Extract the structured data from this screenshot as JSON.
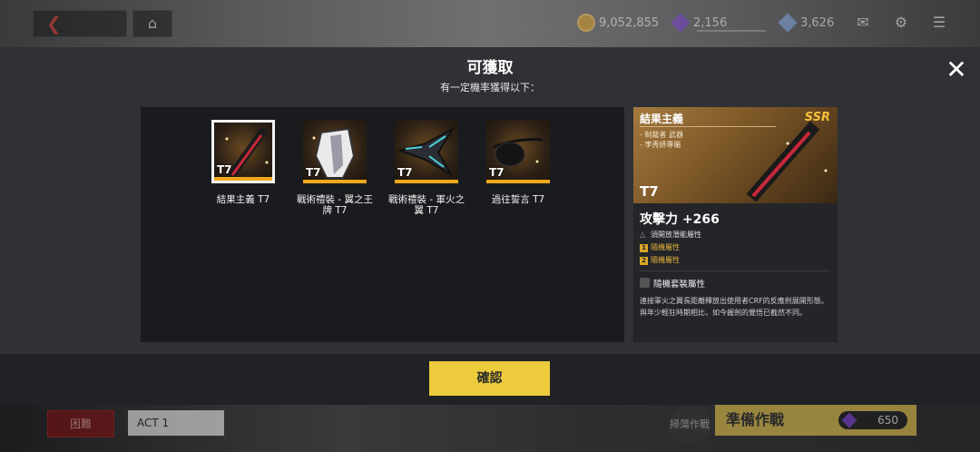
{
  "topbar": {
    "gold": "9,052,855",
    "gems": "2,156",
    "crystals": "3,626"
  },
  "bottombar": {
    "difficulty": "困難",
    "act": "ACT 1",
    "sweep": "掃蕩作戰",
    "prepare": "準備作戰",
    "prepare_cost": "650"
  },
  "modal": {
    "title": "可獲取",
    "subtitle": "有一定機率獲得以下：",
    "confirm": "確認"
  },
  "items": [
    {
      "tier": "T7",
      "label": "結果主義 T7",
      "selected": true
    },
    {
      "tier": "T7",
      "label": "戰術禮裝 - 翼之王牌 T7",
      "selected": false
    },
    {
      "tier": "T7",
      "label": "戰術禮裝 - 軍火之翼 T7",
      "selected": false
    },
    {
      "tier": "T7",
      "label": "過往誓言 T7",
      "selected": false
    }
  ],
  "detail": {
    "name": "結果主義",
    "rarity": "SSR",
    "tags": [
      "- 制裁者 武器",
      "- 李秀妍專屬"
    ],
    "tier": "T7",
    "stat": "攻擊力 +266",
    "potential": "須開放潛能屬性",
    "random1": "隨機屬性",
    "random2": "隨機屬性",
    "set_label": "隨機套裝屬性",
    "description": "連接軍火之翼長距離釋放出使用者CRF的反應劍展開形態。與年少輕狂時期相比，如今握劍的覺悟已截然不同。"
  },
  "colors": {
    "accent": "#eccb3c",
    "rarity": "#f0a81e",
    "ssr": "#f3c13a"
  }
}
